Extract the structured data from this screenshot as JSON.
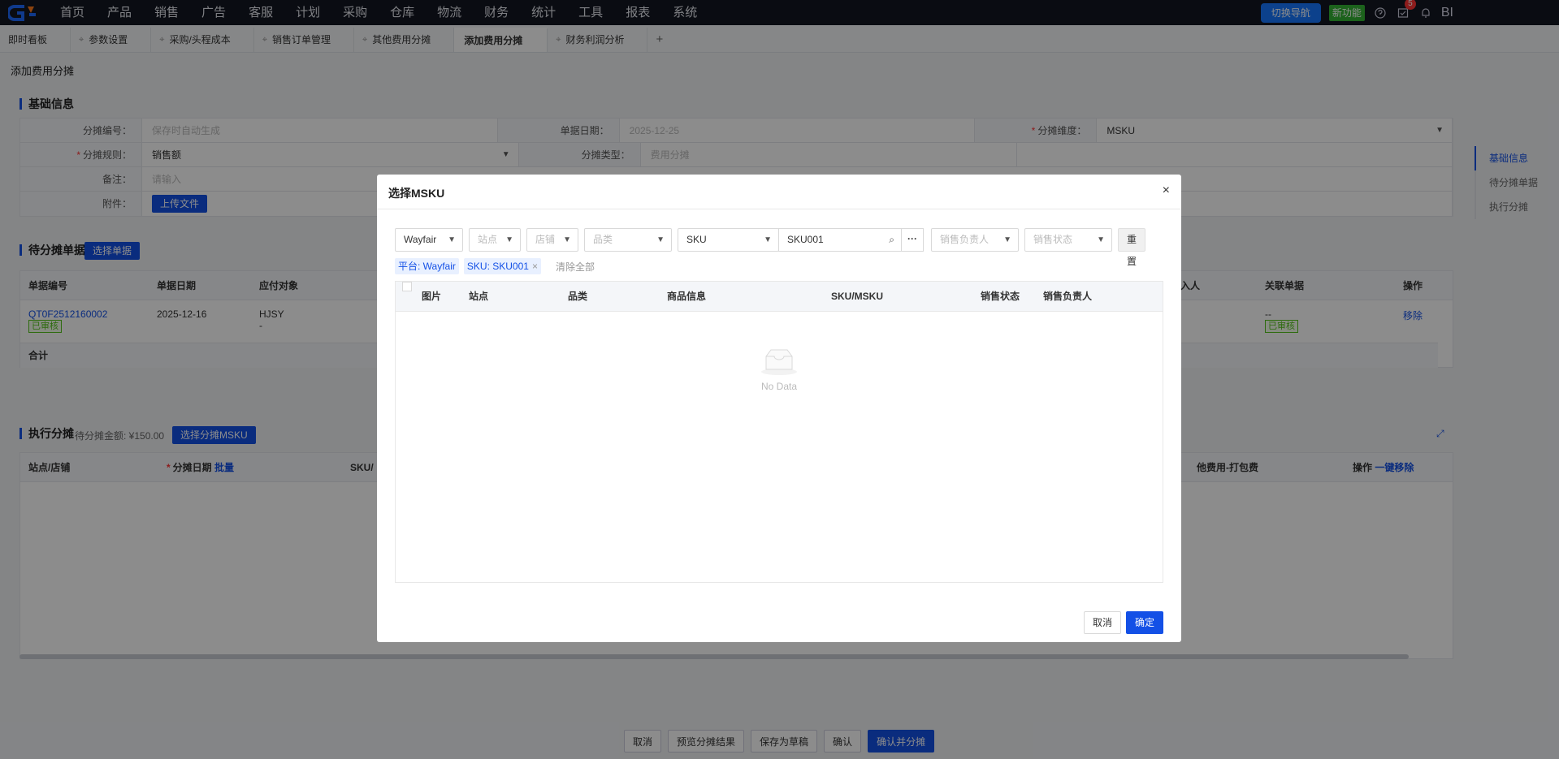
{
  "topnav": {
    "menu": [
      "首页",
      "产品",
      "销售",
      "广告",
      "客服",
      "计划",
      "采购",
      "仓库",
      "物流",
      "财务",
      "统计",
      "工具",
      "报表",
      "系统"
    ],
    "switch_nav": "切换导航",
    "new_feature": "新功能",
    "notification_count": "5",
    "bi_label": "BI"
  },
  "tabs": [
    {
      "label": "即时看板"
    },
    {
      "label": "参数设置"
    },
    {
      "label": "采购/头程成本"
    },
    {
      "label": "销售订单管理"
    },
    {
      "label": "其他费用分摊"
    },
    {
      "label": "添加费用分摊"
    },
    {
      "label": "财务利润分析"
    }
  ],
  "page": {
    "title": "添加费用分摊",
    "basic_info": {
      "section_title": "基础信息",
      "fields": {
        "code_label": "分摊编号：",
        "code_value": "保存时自动生成",
        "date_label": "单据日期：",
        "date_value": "2025-12-25",
        "dimension_label": "分摊维度：",
        "dimension_value": "MSKU",
        "rule_label": "分摊规则：",
        "rule_value": "销售额",
        "type_label": "分摊类型：",
        "type_value": "费用分摊",
        "remark_label": "备注：",
        "remark_placeholder": "请输入",
        "attach_label": "附件：",
        "upload_btn": "上传文件"
      }
    },
    "pending": {
      "section_title": "待分摊单据",
      "select_btn": "选择单据",
      "headers": [
        "单据编号",
        "单据日期",
        "应付对象",
        "入人",
        "关联单据",
        "操作"
      ],
      "row": {
        "code": "QT0F2512160002",
        "status": "已审核",
        "date": "2025-12-16",
        "payee": "HJSY",
        "payee_sub": "-",
        "related": "--",
        "related_status": "已审核",
        "action": "移除"
      },
      "total_label": "合计"
    },
    "execute": {
      "section_title": "执行分摊",
      "amount_label": "待分摊金额: ¥150.00",
      "select_btn": "选择分摊MSKU",
      "headers": {
        "store": "站点/店铺",
        "date": "分摊日期",
        "batch": "批量",
        "sku": "SKU/",
        "fee": "他费用-打包费",
        "op": "操作",
        "remove_all": "一键移除"
      }
    },
    "anchors": [
      "基础信息",
      "待分摊单据",
      "执行分摊"
    ],
    "bottom_buttons": [
      "取消",
      "预览分摊结果",
      "保存为草稿",
      "确认",
      "确认并分摊"
    ]
  },
  "modal": {
    "title": "选择MSKU",
    "filters": {
      "platform": "Wayfair",
      "site": "站点",
      "store": "店铺",
      "category": "品类",
      "search_type": "SKU",
      "search_value": "SKU001",
      "sales_owner": "销售负责人",
      "sales_status": "销售状态",
      "reset": "重置"
    },
    "chips": {
      "platform": "平台: Wayfair",
      "sku": "SKU: SKU001",
      "clear_all": "清除全部"
    },
    "columns": [
      "图片",
      "站点",
      "品类",
      "商品信息",
      "SKU/MSKU",
      "销售状态",
      "销售负责人"
    ],
    "empty_text": "No Data",
    "cancel": "取消",
    "confirm": "确定"
  }
}
